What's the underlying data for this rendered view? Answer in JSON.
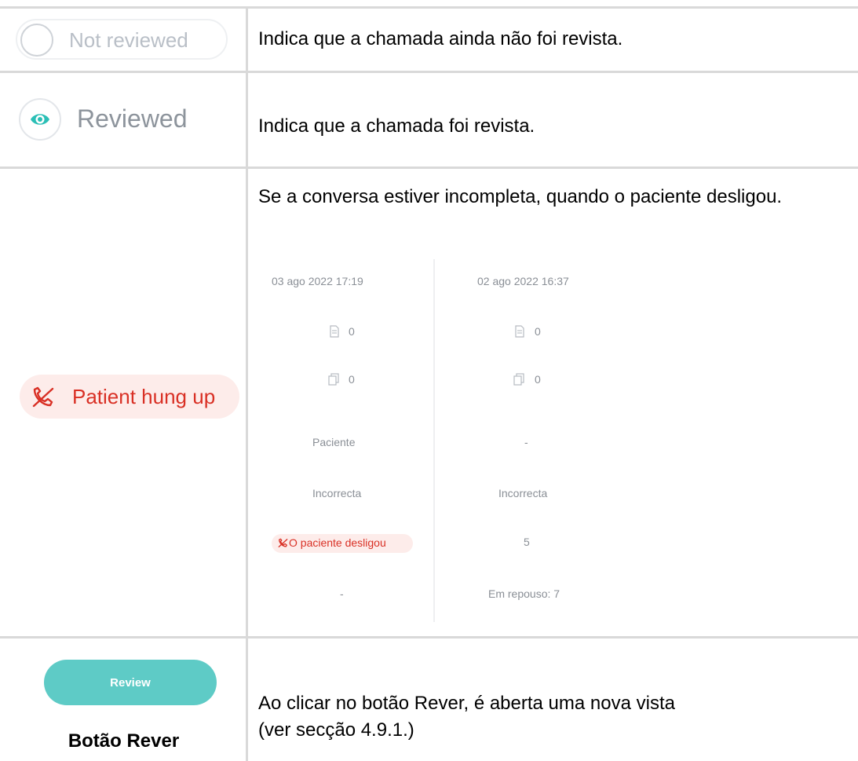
{
  "rows": {
    "not_reviewed": {
      "status_label": "Not reviewed",
      "description": "Indica que a chamada ainda não foi revista."
    },
    "reviewed": {
      "status_label": "Reviewed",
      "description": "Indica que a chamada foi revista.",
      "accent_color": "#2bbfb6"
    },
    "patient_hung_up": {
      "status_label": "Patient hung up",
      "description": "Se a conversa estiver incompleta, quando o paciente desligou.",
      "badge_color": "#d93025",
      "mockup": {
        "columns": [
          {
            "date": "03 ago 2022 17:19",
            "documents_count": "0",
            "copies_count": "0",
            "caller": "Paciente",
            "classification": "Incorrecta",
            "status_badge": "O paciente desligou",
            "extra": "-"
          },
          {
            "date": "02 ago 2022 16:37",
            "documents_count": "0",
            "copies_count": "0",
            "caller": "-",
            "classification": "Incorrecta",
            "score": "5",
            "extra": "Em repouso: 7"
          }
        ]
      }
    },
    "review_button": {
      "button_label": "Review",
      "caption": "Botão Rever",
      "description_line1": "Ao clicar no botão Rever, é aberta uma nova vista",
      "description_line2": "(ver secção 4.9.1.)",
      "button_color": "#5ecbc6"
    }
  }
}
